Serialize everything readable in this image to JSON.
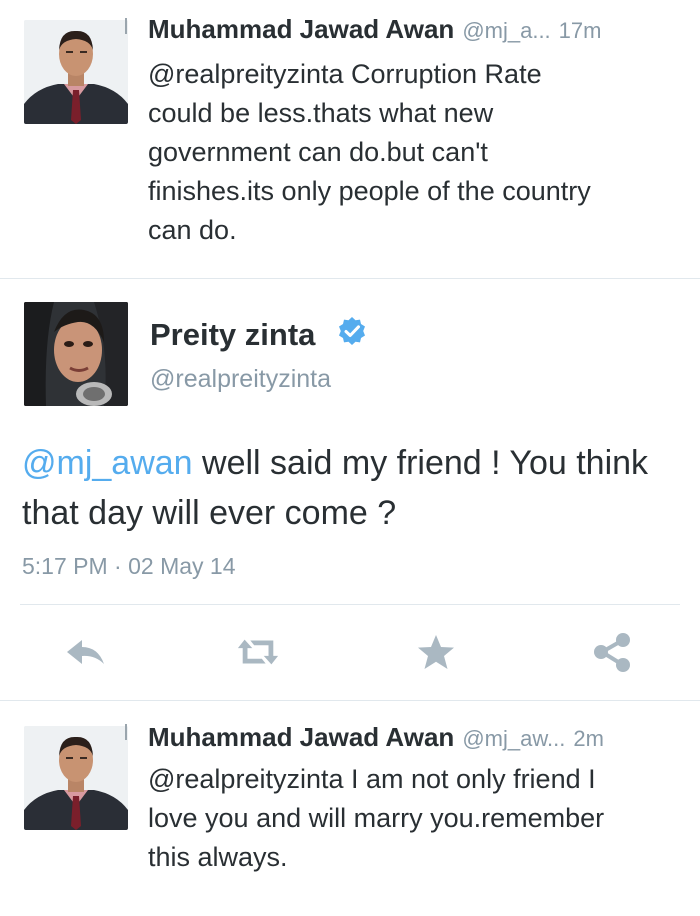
{
  "tweets": [
    {
      "author": "Muhammad Jawad Awan",
      "handle": "@mj_a...",
      "time": "17m",
      "text": "@realpreityzinta Corruption Rate\ncould be less.thats what  new\ngovernment  can do.but can't\nfinishes.its only people of the country\ncan do."
    },
    {
      "author": "Muhammad Jawad Awan",
      "handle": "@mj_aw...",
      "time": "2m",
      "text": "@realpreityzinta I am not only friend I\nlove you and will marry you.remember\nthis always."
    }
  ],
  "main_tweet": {
    "name": "Preity zinta",
    "handle": "@realpreityzinta",
    "mention": "@mj_awan",
    "text": " well said my friend ! You think that day will ever come ?",
    "timestamp": "5:17 PM · 02 May 14"
  },
  "actions": {
    "reply_icon": "reply-icon",
    "retweet_icon": "retweet-icon",
    "favorite_icon": "star-icon",
    "share_icon": "share-icon"
  },
  "colors": {
    "link": "#55acee",
    "verified": "#55acee",
    "muted": "#8899a6",
    "action_icon": "#aab8c2"
  }
}
